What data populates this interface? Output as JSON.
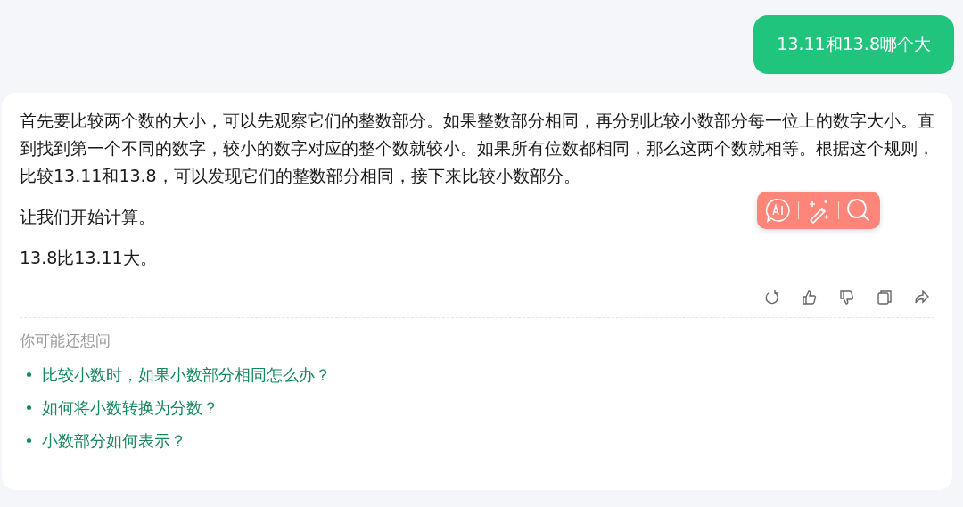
{
  "user_message": {
    "text": "13.11和13.8哪个大"
  },
  "answer": {
    "paragraphs": [
      "首先要比较两个数的大小，可以先观察它们的整数部分。如果整数部分相同，再分别比较小数部分每一位上的数字大小。直到找到第一个不同的数字，较小的数字对应的整个数就较小。如果所有位数都相同，那么这两个数就相等。根据这个规则，比较13.11和13.8，可以发现它们的整数部分相同，接下来比较小数部分。",
      "让我们开始计算。",
      "13.8比13.11大。"
    ]
  },
  "suggestions": {
    "title": "你可能还想问",
    "items": [
      "比较小数时，如果小数部分相同怎么办？",
      "如何将小数转换为分数？",
      "小数部分如何表示？"
    ]
  }
}
